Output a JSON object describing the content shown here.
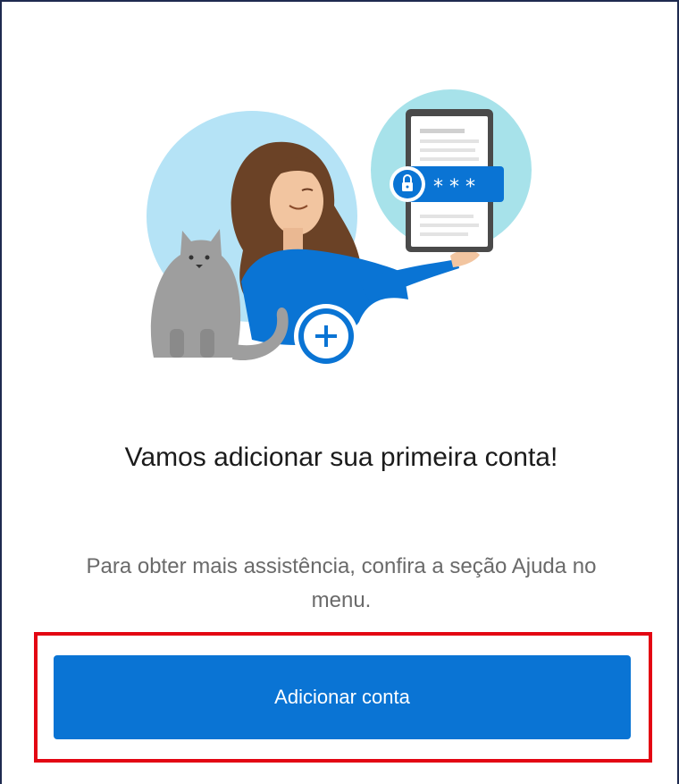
{
  "onboarding": {
    "title": "Vamos adicionar sua primeira conta!",
    "subtitle": "Para obter mais assistência, confira a seção Ajuda no menu.",
    "add_account_label": "Adicionar conta",
    "password_mask": "* * *"
  },
  "icons": {
    "plus": "plus-icon",
    "lock": "lock-icon",
    "illustration": "woman-with-cat-and-phone-illustration"
  },
  "colors": {
    "primary": "#0a74d4",
    "highlight_border": "#e30613",
    "illustration_bg": "#b5e3f6",
    "phone_bg": "#a7e2ea"
  }
}
